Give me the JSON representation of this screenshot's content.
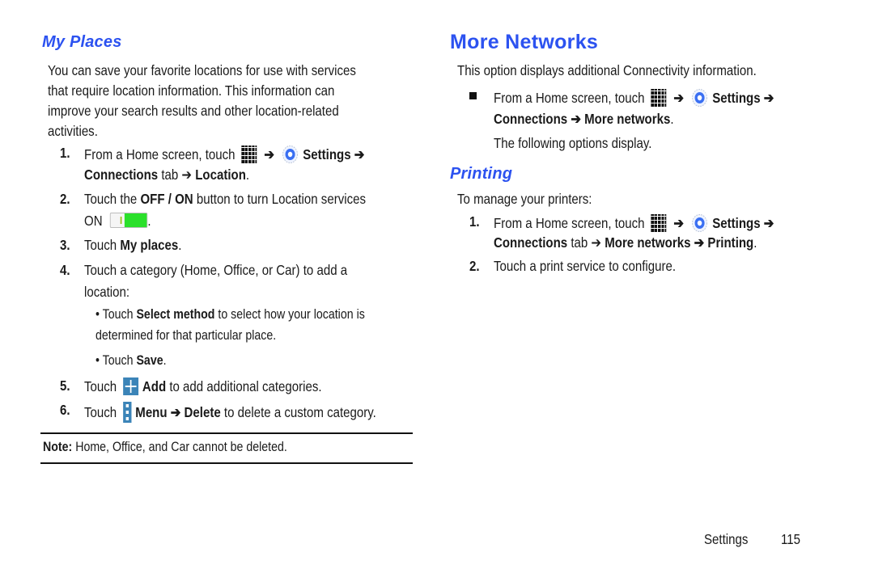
{
  "left": {
    "heading": "My Places",
    "intro_lines": [
      "You can save your favorite locations for use with services",
      "that require location information. This information can",
      "improve your search results and other location-related",
      "activities."
    ],
    "steps": {
      "s1_num": "1.",
      "s1_a": "From a Home screen, touch",
      "s1_arrow": "➔",
      "s1_settings": "Settings ➔",
      "s1_b_bold": "Connections",
      "s1_b_text": " tab ➔ ",
      "s1_b_loc": "Location",
      "s1_b_end": ".",
      "s2_num": "2.",
      "s2_a": "Touch the ",
      "s2_bold": "OFF / ON",
      "s2_b": " button to turn Location services",
      "s2_on": "ON",
      "s2_end": ".",
      "s3_num": "3.",
      "s3_a": "Touch ",
      "s3_bold": "My places",
      "s3_end": ".",
      "s4_num": "4.",
      "s4_a": "Touch a category (Home, Office, or Car) to add a",
      "s4_b": "location:",
      "b1_bullet": "•",
      "b1_a": " Touch ",
      "b1_bold": "Select method",
      "b1_b": " to select how your location is",
      "b1_c": "determined for that particular place.",
      "b2_bullet": "•",
      "b2_a": " Touch ",
      "b2_bold": "Save",
      "b2_end": ".",
      "s5_num": "5.",
      "s5_a": "Touch",
      "s5_bold": "Add",
      "s5_b": " to add additional categories.",
      "s6_num": "6.",
      "s6_a": "Touch",
      "s6_bold1": "Menu ➔ Delete",
      "s6_b": " to delete a custom category."
    },
    "note_label": "Note:",
    "note_text": " Home, Office, and Car cannot be deleted."
  },
  "right": {
    "title": "More Networks",
    "intro": "This option displays additional Connectivity information.",
    "bullet_a": "From a Home screen, touch",
    "bullet_arrow": "➔",
    "bullet_settings": "Settings ➔",
    "bullet_b": "Connections ➔ More networks",
    "bullet_b_end": ".",
    "following": "The following options display.",
    "printing": {
      "heading": "Printing",
      "intro": "To manage your printers:",
      "s1_num": "1.",
      "s1_a": "From a Home screen, touch",
      "s1_arrow": "➔",
      "s1_settings": "Settings ➔",
      "s1_b_bold": "Connections",
      "s1_b_text": " tab ➔ ",
      "s1_b_bold2": "More networks ➔ Printing",
      "s1_b_end": ".",
      "s2_num": "2.",
      "s2_a": "Touch a print service to configure."
    }
  },
  "footer": {
    "section": "Settings",
    "page": "115"
  },
  "colors": {
    "heading_blue": "#2c52f0",
    "icon_blue": "#3b84b8",
    "toggle_green": "#2be02b"
  }
}
